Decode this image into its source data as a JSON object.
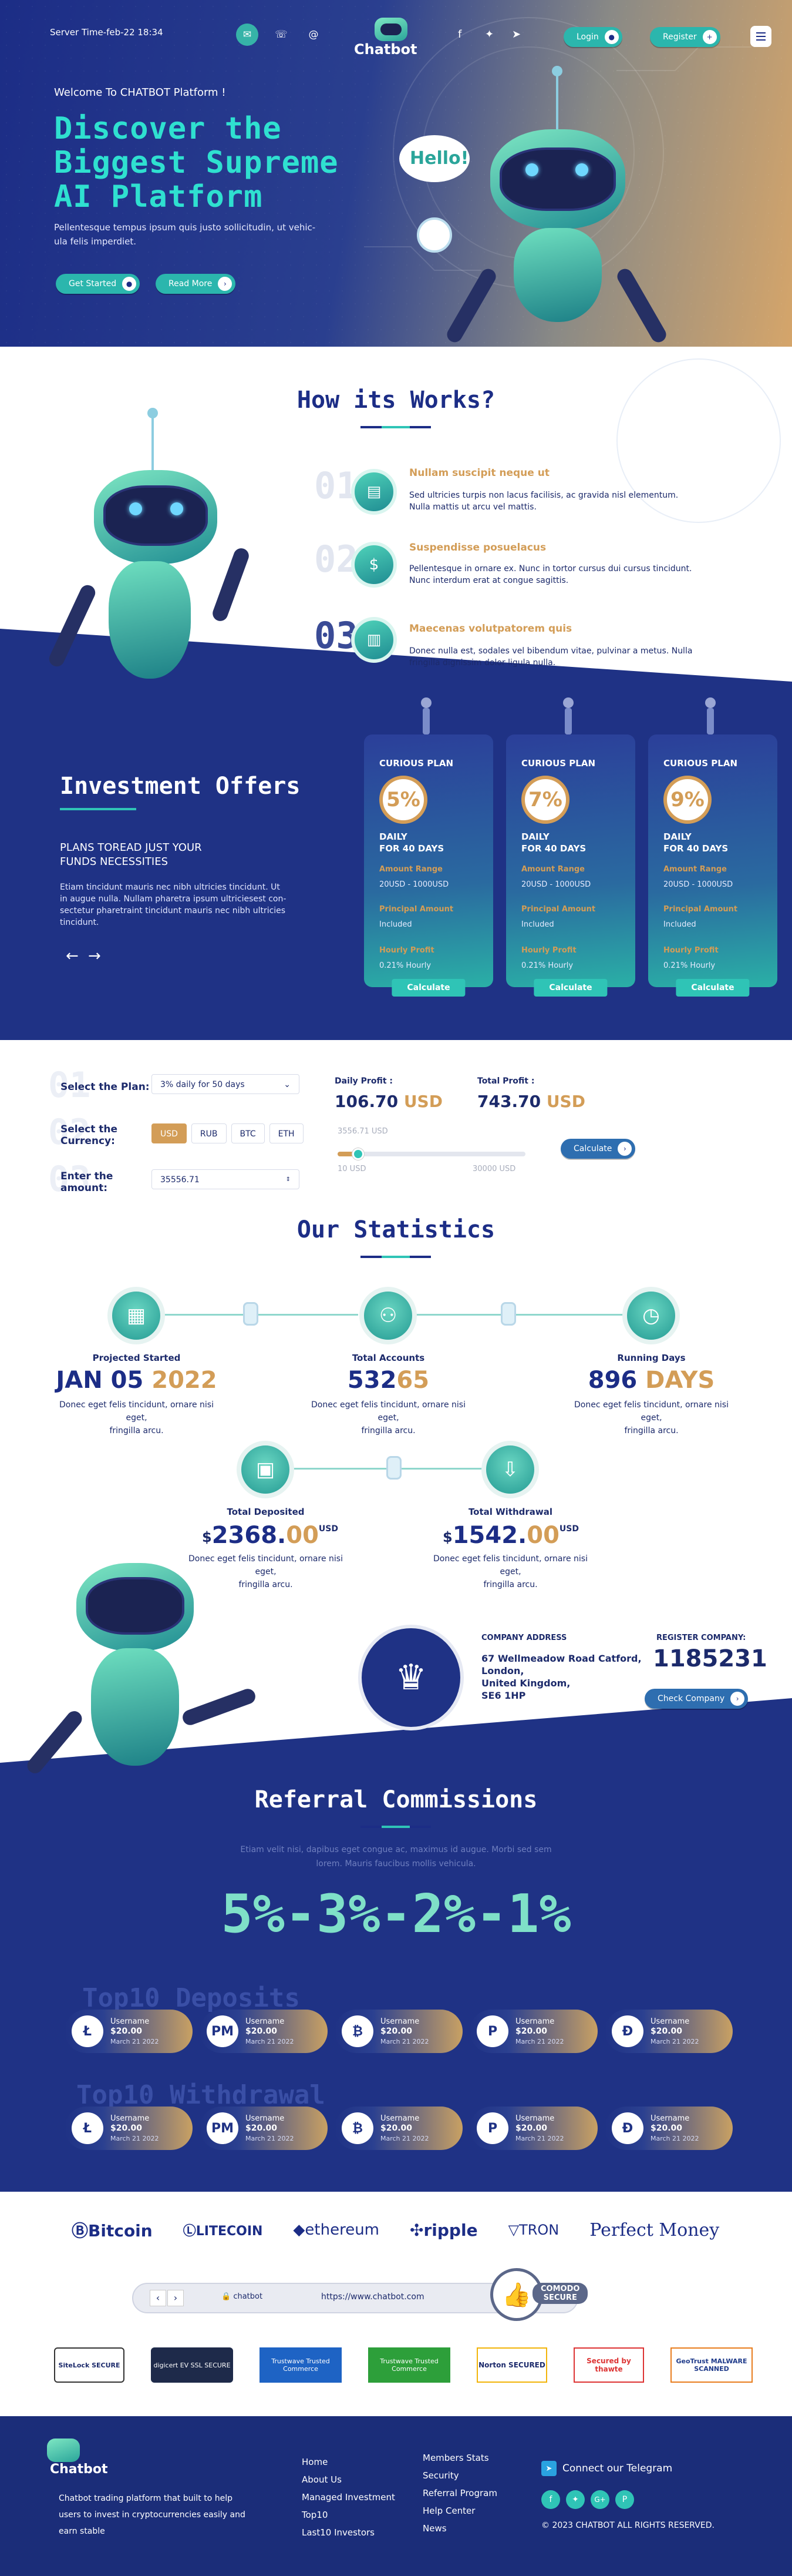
{
  "header": {
    "server_time": "Server Time-feb-22 18:34",
    "logo_text": "Chatbot",
    "login_label": "Login",
    "register_label": "Register"
  },
  "hero": {
    "welcome": "Welcome To CHATBOT Platform !",
    "title_line1": "Discover the",
    "title_line2": "Biggest Supreme",
    "title_line3": "AI Platform",
    "text_line1": "Pellentesque tempus ipsum quis justo sollicitudin, ut vehic-",
    "text_line2": "ula felis imperdiet.",
    "get_started": "Get Started",
    "read_more": "Read More",
    "bubble": "Hello!"
  },
  "how": {
    "title": "How its Works?",
    "steps": [
      {
        "num": "01",
        "title": "Nullam suscipit neque ut",
        "l1": "Sed ultricies turpis non lacus facilisis, ac gravida nisl elementum.",
        "l2": "Nulla mattis ut arcu vel mattis."
      },
      {
        "num": "02",
        "title": "Suspendisse posuelacus",
        "l1": "Pellentesque in ornare ex. Nunc in tortor cursus dui cursus tincidunt.",
        "l2": "Nunc interdum erat at congue sagittis."
      },
      {
        "num": "03",
        "title": "Maecenas volutpatorem quis",
        "l1": "Donec nulla est, sodales vel bibendum vitae, pulvinar a metus. Nulla",
        "l2": "fringilla dignissim dolor ligula nulla."
      }
    ]
  },
  "invest": {
    "title": "Investment Offers",
    "sub1": "PLANS TOREAD JUST YOUR",
    "sub2": "FUNDS NECESSITIES",
    "p1": "Etiam tincidunt mauris nec nibh ultricies tincidunt. Ut",
    "p2": "in augue nulla. Nullam pharetra ipsum ultriciesest con-",
    "p3": "sectetur pharetraint tincidunt mauris nec nibh ultricies",
    "p4": "tincidunt.",
    "plans": [
      {
        "name": "CURIOUS PLAN",
        "pct": "5%",
        "daily": "DAILY",
        "days": "FOR 40 DAYS",
        "range_lbl": "Amount Range",
        "range": "20USD - 1000USD",
        "principal_lbl": "Principal Amount",
        "principal": "Included",
        "hourly_lbl": "Hourly Profit",
        "hourly": "0.21% Hourly",
        "btn": "Calculate"
      },
      {
        "name": "CURIOUS PLAN",
        "pct": "7%",
        "daily": "DAILY",
        "days": "FOR 40 DAYS",
        "range_lbl": "Amount Range",
        "range": "20USD - 1000USD",
        "principal_lbl": "Principal Amount",
        "principal": "Included",
        "hourly_lbl": "Hourly Profit",
        "hourly": "0.21% Hourly",
        "btn": "Calculate"
      },
      {
        "name": "CURIOUS PLAN",
        "pct": "9%",
        "daily": "DAILY",
        "days": "FOR 40 DAYS",
        "range_lbl": "Amount Range",
        "range": "20USD - 1000USD",
        "principal_lbl": "Principal Amount",
        "principal": "Included",
        "hourly_lbl": "Hourly Profit",
        "hourly": "0.21% Hourly",
        "btn": "Calculate"
      }
    ]
  },
  "calc": {
    "plan_lbl": "Select the Plan:",
    "plan_val": "3% daily for 50 days",
    "currency_lbl1": "Select the",
    "currency_lbl2": "Currency:",
    "currencies": [
      "USD",
      "RUB",
      "BTC",
      "ETH"
    ],
    "amount_lbl1": "Enter the",
    "amount_lbl2": "amount:",
    "amount_val": "35556.71",
    "daily_lbl": "Daily Profit :",
    "daily_val": "106.70 USD",
    "total_lbl": "Total Profit :",
    "total_val": "743.70 USD",
    "slider_val": "3556.71 USD",
    "slider_level": 0.11,
    "slider_min": "10 USD",
    "slider_max": "30000 USD",
    "calc_btn": "Calculate",
    "nums": [
      "01",
      "02",
      "03"
    ]
  },
  "stats": {
    "title": "Our Statistics",
    "items": [
      {
        "title": "Projected Started",
        "value": "JAN 05 2022",
        "d1": "Donec eget felis tincidunt, ornare nisi eget,",
        "d2": "fringilla arcu."
      },
      {
        "title": "Total Accounts",
        "value": "53265",
        "d1": "Donec eget felis tincidunt, ornare nisi eget,",
        "d2": "fringilla arcu."
      },
      {
        "title": "Running Days",
        "value": "896 DAYS",
        "d1": "Donec eget felis tincidunt, ornare nisi eget,",
        "d2": "fringilla arcu."
      },
      {
        "title": "Total Deposited",
        "value": "2368.00",
        "d1": "Donec eget felis tincidunt, ornare nisi eget,",
        "d2": "fringilla arcu."
      },
      {
        "title": "Total Withdrawal",
        "value": "1542.00",
        "d1": "Donec eget felis tincidunt, ornare nisi eget,",
        "d2": "fringilla arcu."
      }
    ],
    "currency_sign": "$",
    "usd": "USD"
  },
  "company": {
    "addr_lbl": "COMPANY ADDRESS",
    "addr1": "67 Wellmeadow Road Catford,",
    "addr2": "London,",
    "addr3": "United Kingdom,",
    "addr4": "SE6 1HP",
    "reg_lbl": "REGISTER COMPANY:",
    "reg_num": "1185231",
    "check_btn": "Check Company"
  },
  "referral": {
    "title": "Referral Commissions",
    "p1": "Etiam velit nisi, dapibus eget congue ac, maximus id augue. Morbi sed sem",
    "p2": "lorem. Mauris faucibus mollis vehicula.",
    "levels": "5%-3%-2%-1%",
    "deposits_title": "Top10 Deposits",
    "withdrawal_title": "Top10 Withdrawal",
    "deposits": [
      {
        "coin": "Ł",
        "user": "Username",
        "amt": "$20.00",
        "date": "March 21 2022"
      },
      {
        "coin": "PM",
        "user": "Username",
        "amt": "$20.00",
        "date": "March 21 2022"
      },
      {
        "coin": "₿",
        "user": "Username",
        "amt": "$20.00",
        "date": "March 21 2022"
      },
      {
        "coin": "P",
        "user": "Username",
        "amt": "$20.00",
        "date": "March 21 2022"
      },
      {
        "coin": "Đ",
        "user": "Username",
        "amt": "$20.00",
        "date": "March 21 2022"
      }
    ],
    "withdrawals": [
      {
        "coin": "Ł",
        "user": "Username",
        "amt": "$20.00",
        "date": "March 21 2022"
      },
      {
        "coin": "PM",
        "user": "Username",
        "amt": "$20.00",
        "date": "March 21 2022"
      },
      {
        "coin": "₿",
        "user": "Username",
        "amt": "$20.00",
        "date": "March 21 2022"
      },
      {
        "coin": "P",
        "user": "Username",
        "amt": "$20.00",
        "date": "March 21 2022"
      },
      {
        "coin": "Đ",
        "user": "Username",
        "amt": "$20.00",
        "date": "March 21 2022"
      }
    ]
  },
  "payments": [
    "Bitcoin",
    "LITECOIN",
    "ethereum",
    "ripple",
    "TRON",
    "Perfect Money"
  ],
  "browser": {
    "tab": "chatbot",
    "url": "https://www.chatbot.com",
    "comodo1": "COMODO",
    "comodo2": "SECURE"
  },
  "badges": [
    "SiteLock SECURE",
    "digicert EV SSL SECURE",
    "Trustwave Trusted Commerce",
    "Trustwave Trusted Commerce",
    "Norton SECURED",
    "Secured by thawte",
    "GeoTrust MALWARE SCANNED"
  ],
  "footer": {
    "logo_text": "Chatbot",
    "desc1": "Chatbot trading platform that built to help",
    "desc2": "users to invest in cryptocurrencies easily and",
    "desc3": "earn stable",
    "col1": [
      "Home",
      "About Us",
      "Managed Investment",
      "Top10",
      "Last10 Investors"
    ],
    "col2": [
      "Members Stats",
      "Security",
      "Referral Program",
      "Help Center",
      "News"
    ],
    "telegram": "Connect our Telegram",
    "copyright": "© 2023  CHATBOT  ALL RIGHTS RESERVED."
  },
  "colors": {
    "navy": "#1c2d86",
    "teal": "#2fc4b6",
    "gold": "#d39d57"
  }
}
